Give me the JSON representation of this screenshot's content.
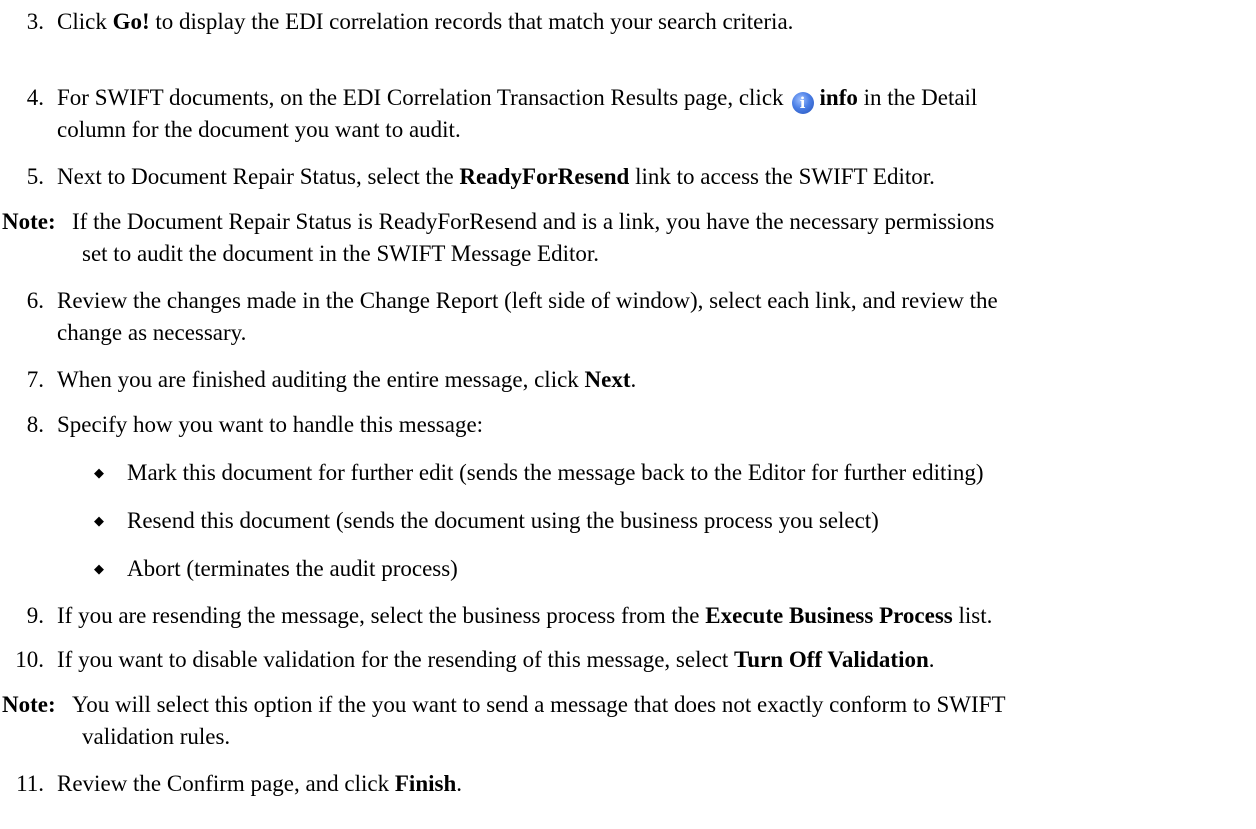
{
  "steps": {
    "s3": {
      "num": "3.",
      "pre": "Click ",
      "bold": "Go!",
      "post": " to display the EDI correlation records that match your search criteria."
    },
    "s4": {
      "num": "4.",
      "pre": "For SWIFT documents, on the EDI Correlation Transaction Results page, click",
      "icon": "info-icon",
      "bold": "info",
      "post": " in the Detail",
      "line2": "column for the document you want to audit."
    },
    "s5": {
      "num": "5.",
      "pre": "Next to Document Repair Status, select the ",
      "bold": "ReadyForResend",
      "post": " link to access the SWIFT Editor."
    },
    "s6": {
      "num": "6.",
      "line1": "Review the changes made in the Change Report (left side of window), select each link, and review the",
      "line2": "change as necessary."
    },
    "s7": {
      "num": "7.",
      "pre": "When you are finished auditing the entire message, click ",
      "bold": "Next",
      "post": "."
    },
    "s8": {
      "num": "8.",
      "text": "Specify how you want to handle this message:",
      "bullets": [
        "Mark this document for further edit (sends the message back to the Editor for further editing)",
        "Resend this document (sends the document using the business process you select)",
        "Abort (terminates the audit process)"
      ]
    },
    "s9": {
      "num": "9.",
      "pre": "If you are resending the message, select the business process from the ",
      "bold": "Execute Business Process",
      "post": " list."
    },
    "s10": {
      "num": "10.",
      "pre": "If you want to disable validation for the resending of this message, select ",
      "bold": "Turn Off Validation",
      "post": "."
    },
    "s11": {
      "num": "11.",
      "pre": "Review the Confirm page, and click ",
      "bold": "Finish",
      "post": "."
    }
  },
  "notes": [
    {
      "label": "Note:",
      "line1": "If the Document Repair Status is ReadyForResend and is a link, you have the necessary permissions",
      "line2": "set to audit the document in the SWIFT Message Editor."
    },
    {
      "label": "Note:",
      "line1": "You will select this option if the you want to send a message that does not exactly conform to SWIFT",
      "line2": "validation rules."
    }
  ]
}
